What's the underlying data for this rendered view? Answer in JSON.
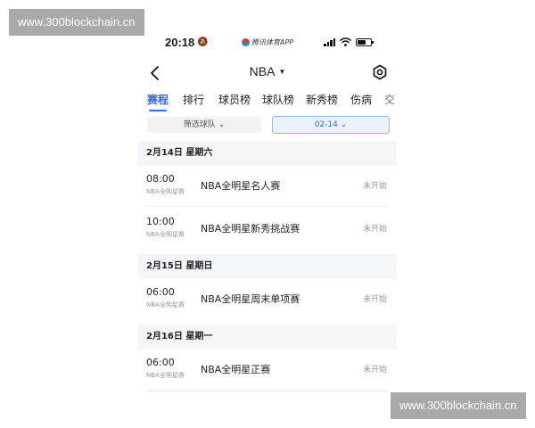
{
  "watermark": {
    "top": "www.300blockchain.cn",
    "bottom": "www.300blockchain.cn"
  },
  "status_bar": {
    "time": "20:18",
    "app_name": "腾讯体育APP"
  },
  "nav": {
    "title": "NBA"
  },
  "tabs": [
    "赛程",
    "排行",
    "球员榜",
    "球队榜",
    "新秀榜",
    "伤病",
    "交"
  ],
  "active_tab": "赛程",
  "filters": {
    "team": "筛选球队",
    "date": "02-14"
  },
  "schedule": [
    {
      "date": "2月14日  星期六",
      "games": [
        {
          "time": "08:00",
          "category": "NBA全明星赛",
          "name": "NBA全明星名人赛",
          "status": "未开始"
        },
        {
          "time": "10:00",
          "category": "NBA全明星赛",
          "name": "NBA全明星新秀挑战赛",
          "status": "未开始"
        }
      ]
    },
    {
      "date": "2月15日  星期日",
      "games": [
        {
          "time": "06:00",
          "category": "NBA全明星赛",
          "name": "NBA全明星周末单项赛",
          "status": "未开始"
        }
      ]
    },
    {
      "date": "2月16日  星期一",
      "games": [
        {
          "time": "06:00",
          "category": "NBA全明星赛",
          "name": "NBA全明星正赛",
          "status": "未开始"
        }
      ]
    }
  ]
}
